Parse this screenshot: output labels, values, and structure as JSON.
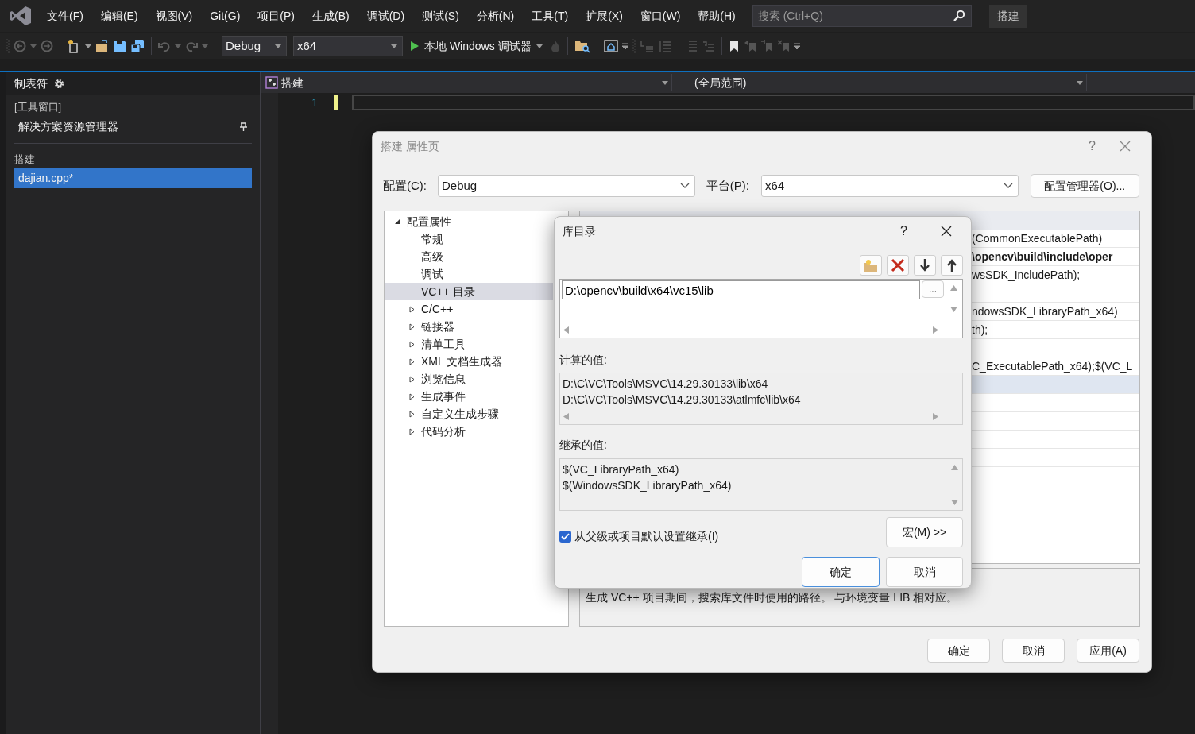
{
  "menu": [
    "文件(F)",
    "编辑(E)",
    "视图(V)",
    "Git(G)",
    "项目(P)",
    "生成(B)",
    "调试(D)",
    "测试(S)",
    "分析(N)",
    "工具(T)",
    "扩展(X)",
    "窗口(W)",
    "帮助(H)"
  ],
  "search": {
    "placeholder": "搜索 (Ctrl+Q)"
  },
  "solution_name": "搭建",
  "toolbar": {
    "configuration": "Debug",
    "platform": "x64",
    "start_button": "本地 Windows 调试器"
  },
  "side_panel": {
    "title": "制表符",
    "groups": [
      {
        "label": "[工具窗口]",
        "items": [
          {
            "label": "解决方案资源管理器",
            "selected": false,
            "pinned": true
          }
        ]
      },
      {
        "label": "搭建",
        "items": [
          {
            "label": "dajian.cpp*",
            "selected": true,
            "pinned": false
          }
        ]
      }
    ]
  },
  "editor": {
    "project_dropdown": "搭建",
    "scope_dropdown": "(全局范围)",
    "line_numbers": [
      "1"
    ]
  },
  "property_dialog": {
    "title": "搭建 属性页",
    "help": "?",
    "config_label": "配置(C):",
    "config_value": "Debug",
    "platform_label": "平台(P):",
    "platform_value": "x64",
    "config_manager_button": "配置管理器(O)...",
    "tree": [
      {
        "kind": "group",
        "label": "配置属性",
        "expanded": true,
        "selected": false,
        "children": [
          {
            "kind": "leaf",
            "label": "常规",
            "selected": false
          },
          {
            "kind": "leaf",
            "label": "高级",
            "selected": false
          },
          {
            "kind": "leaf",
            "label": "调试",
            "selected": false
          },
          {
            "kind": "leaf",
            "label": "VC++ 目录",
            "selected": true
          },
          {
            "kind": "group",
            "label": "C/C++",
            "expanded": false,
            "selected": false
          },
          {
            "kind": "group",
            "label": "链接器",
            "expanded": false,
            "selected": false
          },
          {
            "kind": "group",
            "label": "清单工具",
            "expanded": false,
            "selected": false
          },
          {
            "kind": "group",
            "label": "XML 文档生成器",
            "expanded": false,
            "selected": false
          },
          {
            "kind": "group",
            "label": "浏览信息",
            "expanded": false,
            "selected": false
          },
          {
            "kind": "group",
            "label": "生成事件",
            "expanded": false,
            "selected": false
          },
          {
            "kind": "group",
            "label": "自定义生成步骤",
            "expanded": false,
            "selected": false
          },
          {
            "kind": "group",
            "label": "代码分析",
            "expanded": false,
            "selected": false
          }
        ]
      }
    ],
    "grid_rows": [
      {
        "kind": "value",
        "value": "(CommonExecutablePath)",
        "bold": false,
        "selected": false
      },
      {
        "kind": "value",
        "value": "\\opencv\\build\\include\\oper",
        "bold": true,
        "selected": false
      },
      {
        "kind": "value",
        "value": "wsSDK_IncludePath);",
        "bold": false,
        "selected": false
      },
      {
        "kind": "blank",
        "selected": false
      },
      {
        "kind": "value",
        "value": "ndowsSDK_LibraryPath_x64)",
        "bold": false,
        "selected": false
      },
      {
        "kind": "value",
        "value": "th);",
        "bold": false,
        "selected": false
      },
      {
        "kind": "blank",
        "selected": false
      },
      {
        "kind": "value",
        "value": "C_ExecutablePath_x64);$(VC_L",
        "bold": false,
        "selected": false
      },
      {
        "kind": "blank",
        "selected": true
      },
      {
        "kind": "blank",
        "selected": false
      },
      {
        "kind": "blank",
        "selected": false
      },
      {
        "kind": "blank",
        "selected": false
      },
      {
        "kind": "blank",
        "selected": false
      }
    ],
    "description": "生成 VC++ 项目期间，搜索库文件时使用的路径。 与环境变量 LIB 相对应。",
    "buttons": [
      "确定",
      "取消",
      "应用(A)"
    ]
  },
  "library_dialog": {
    "title": "库目录",
    "help": "?",
    "entries": [
      {
        "value": "D:\\opencv\\build\\x64\\vc15\\lib"
      }
    ],
    "browse_button": "...",
    "computed_label": "计算的值:",
    "computed_values": [
      "D:\\C\\VC\\Tools\\MSVC\\14.29.30133\\lib\\x64",
      "D:\\C\\VC\\Tools\\MSVC\\14.29.30133\\atlmfc\\lib\\x64"
    ],
    "inherited_label": "继承的值:",
    "inherited_values": [
      "$(VC_LibraryPath_x64)",
      "$(WindowsSDK_LibraryPath_x64)"
    ],
    "inherit_checkbox": {
      "label": "从父级或项目默认设置继承(I)",
      "checked": true
    },
    "macros_button": "宏(M) >>",
    "ok_button": "确定",
    "cancel_button": "取消"
  }
}
